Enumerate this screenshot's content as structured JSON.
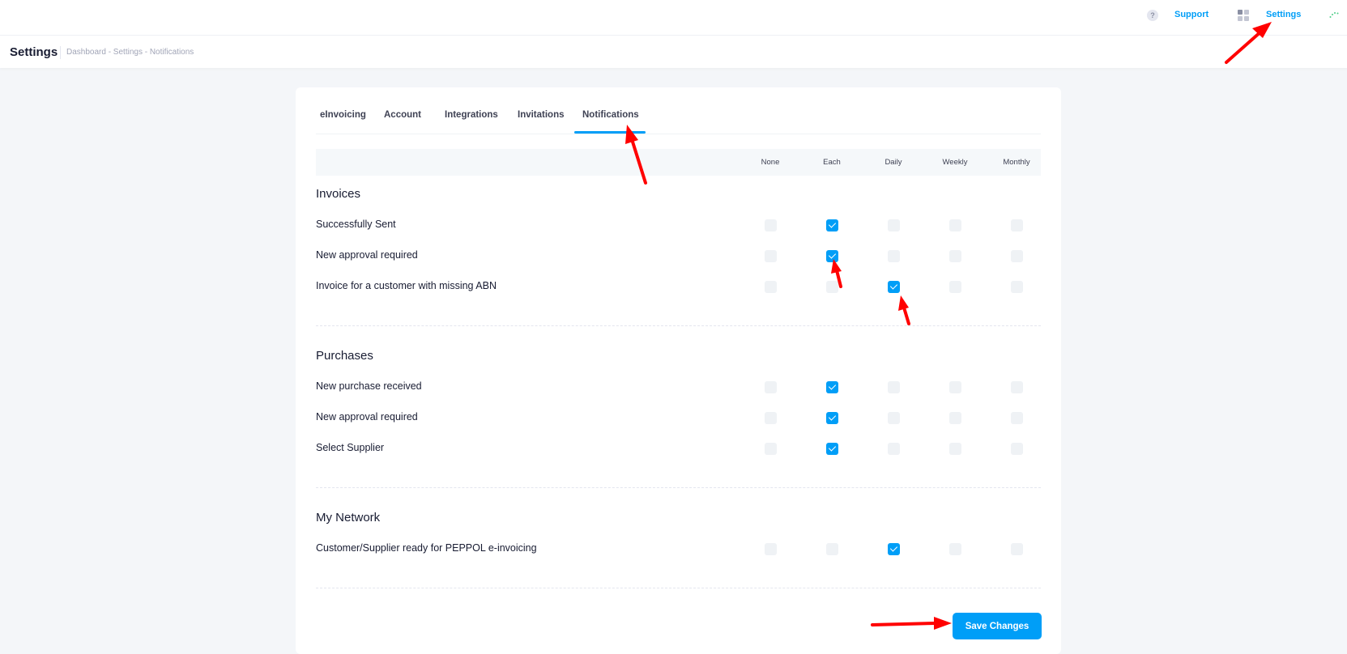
{
  "topbar": {
    "help_icon": "?",
    "support_label": "Support",
    "settings_label": "Settings"
  },
  "subheader": {
    "title": "Settings",
    "breadcrumb": "Dashboard - Settings - Notifications"
  },
  "tabs": [
    {
      "label": "eInvoicing",
      "active": false
    },
    {
      "label": "Account",
      "active": false
    },
    {
      "label": "Integrations",
      "active": false
    },
    {
      "label": "Invitations",
      "active": false
    },
    {
      "label": "Notifications",
      "active": true
    }
  ],
  "columns": [
    "None",
    "Each",
    "Daily",
    "Weekly",
    "Monthly"
  ],
  "sections": [
    {
      "title": "Invoices",
      "rows": [
        {
          "label": "Successfully Sent",
          "selected": "Each"
        },
        {
          "label": "New approval required",
          "selected": "Each"
        },
        {
          "label": "Invoice for a customer with missing ABN",
          "selected": "Daily"
        }
      ]
    },
    {
      "title": "Purchases",
      "rows": [
        {
          "label": "New purchase received",
          "selected": "Each"
        },
        {
          "label": "New approval required",
          "selected": "Each"
        },
        {
          "label": "Select Supplier",
          "selected": "Each"
        }
      ]
    },
    {
      "title": "My Network",
      "rows": [
        {
          "label": "Customer/Supplier ready for PEPPOL e-invoicing",
          "selected": "Daily"
        }
      ]
    }
  ],
  "save_label": "Save Changes",
  "colors": {
    "accent": "#009ef7",
    "annotation_arrow": "#ff0000"
  }
}
